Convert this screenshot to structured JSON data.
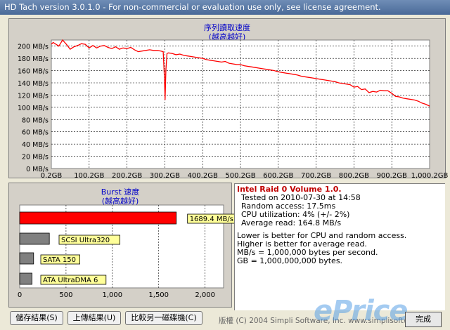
{
  "window": {
    "title": "HD Tach version 3.0.1.0  - For non-commercial or evaluation use only, see license agreement."
  },
  "main_chart": {
    "title_line1": "序列讀取速度",
    "title_line2": "(越高越好)"
  },
  "chart_data": [
    {
      "type": "line",
      "title": "序列讀取速度 (越高越好)",
      "x_tick_labels": [
        "0.2GB",
        "100.2GB",
        "200.2GB",
        "300.2GB",
        "400.2GB",
        "500.2GB",
        "600.2GB",
        "700.2GB",
        "800.2GB",
        "900.2GB",
        "1,000.2GB"
      ],
      "y_tick_labels": [
        "200 MB/s",
        "180 MB/s",
        "160 MB/s",
        "140 MB/s",
        "120 MB/s",
        "100 MB/s",
        "80 MB/s",
        "60 MB/s",
        "40 MB/s",
        "20 MB/s",
        "0 MB/s"
      ],
      "xlim": [
        0.2,
        1000.2
      ],
      "ylim": [
        0,
        210
      ],
      "grid": true,
      "series": [
        {
          "color": "#ff0000",
          "x": [
            0.2,
            5,
            10,
            20,
            30,
            40,
            50,
            60,
            70,
            80,
            90,
            100,
            110,
            120,
            130,
            140,
            150,
            160,
            170,
            180,
            190,
            200,
            210,
            220,
            230,
            240,
            250,
            260,
            270,
            280,
            290,
            296,
            299,
            301,
            303,
            306,
            310,
            320,
            330,
            340,
            350,
            360,
            370,
            380,
            390,
            400,
            410,
            420,
            430,
            440,
            450,
            460,
            470,
            480,
            490,
            500,
            510,
            520,
            530,
            540,
            550,
            560,
            570,
            580,
            590,
            600,
            610,
            620,
            630,
            640,
            650,
            660,
            670,
            680,
            690,
            700,
            710,
            720,
            730,
            740,
            750,
            760,
            770,
            780,
            790,
            800,
            810,
            820,
            830,
            840,
            850,
            860,
            870,
            880,
            890,
            900,
            910,
            920,
            930,
            940,
            950,
            960,
            970,
            980,
            990,
            1000.2
          ],
          "y": [
            203,
            206,
            204,
            200,
            210,
            203,
            195,
            199,
            201,
            204,
            203,
            197,
            201,
            197,
            200,
            201,
            198,
            196,
            199,
            195,
            197,
            196,
            198,
            194,
            191,
            192,
            193,
            194,
            193,
            193,
            192,
            191,
            150,
            112,
            160,
            188,
            189,
            188,
            186,
            187,
            185,
            184,
            183,
            182,
            181,
            180,
            178,
            177,
            176,
            175,
            174,
            175,
            172,
            171,
            170,
            170,
            168,
            167,
            166,
            165,
            164,
            163,
            162,
            161,
            160,
            158,
            157,
            156,
            155,
            154,
            153,
            151,
            150,
            149,
            148,
            147,
            146,
            145,
            144,
            143,
            142,
            140,
            139,
            138,
            137,
            133,
            134,
            129,
            130,
            124,
            126,
            125,
            128,
            127,
            127,
            123,
            118,
            117,
            115,
            114,
            113,
            112,
            110,
            107,
            105,
            102
          ]
        }
      ]
    },
    {
      "type": "bar",
      "title": "Burst 速度 (越高越好)",
      "categories": [
        "",
        "SCSI Ultra320",
        "SATA 150",
        "ATA UltraDMA 6"
      ],
      "values": [
        1689.4,
        320,
        150,
        133
      ],
      "value_labels": [
        "1689.4 MB/s",
        "SCSI Ultra320",
        "SATA 150",
        "ATA UltraDMA 6"
      ],
      "colors": [
        "#ff0000",
        "#808080",
        "#808080",
        "#808080"
      ],
      "x_tick_labels": [
        "0",
        "500",
        "1,000",
        "1,500",
        "2,000"
      ],
      "xlim": [
        0,
        2200
      ]
    }
  ],
  "burst_chart": {
    "title_line1": "Burst 速度",
    "title_line2": "(越高越好)"
  },
  "info": {
    "drive_name": "Intel Raid 0 Volume 1.0.",
    "tested_on": "Tested on 2010-07-30 at 14:58",
    "random_access": "Random access: 17.5ms",
    "cpu": "CPU utilization: 4% (+/- 2%)",
    "avg_read": "Average read: 164.8 MB/s",
    "note1": "Lower is better for CPU and random access.",
    "note2": "Higher is better for average read.",
    "note3": "MB/s = 1,000,000 bytes per second.",
    "note4": "GB = 1,000,000,000 bytes."
  },
  "buttons": {
    "save": "儲存結果(S)",
    "upload": "上傳結果(U)",
    "compare": "比較另一磁碟機(C)",
    "finish": "完成"
  },
  "copyright": "版權 (C) 2004 Simpli Software, Inc. www.simplisoftware.com",
  "watermark": "ePrice"
}
